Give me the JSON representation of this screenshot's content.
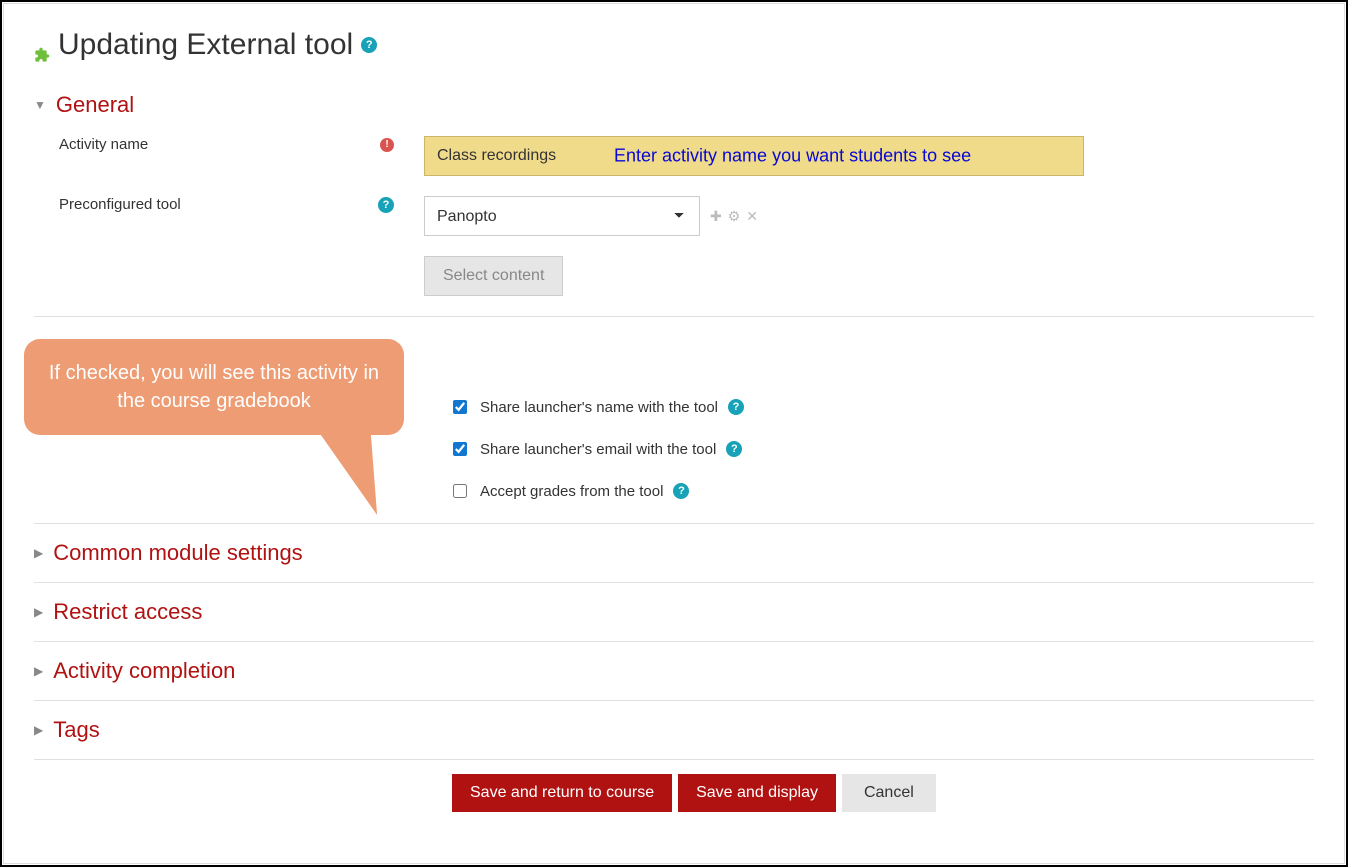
{
  "page": {
    "title": "Updating External tool"
  },
  "general": {
    "heading": "General",
    "activity_name_label": "Activity name",
    "activity_name_value": "Class recordings",
    "activity_name_hint": "Enter activity name you want students to see",
    "preconfigured_tool_label": "Preconfigured tool",
    "preconfigured_tool_value": "Panopto",
    "select_content_button": "Select content"
  },
  "privacy": {
    "share_name_label": "Share launcher's name with the tool",
    "share_email_label": "Share launcher's email with the tool",
    "accept_grades_label": "Accept grades from the tool"
  },
  "callout": {
    "text": "If checked, you will see this activity in the course gradebook"
  },
  "sections": {
    "common_module": "Common module settings",
    "restrict": "Restrict access",
    "completion": "Activity completion",
    "tags": "Tags"
  },
  "buttons": {
    "save_return": "Save and return to course",
    "save_display": "Save and display",
    "cancel": "Cancel"
  }
}
